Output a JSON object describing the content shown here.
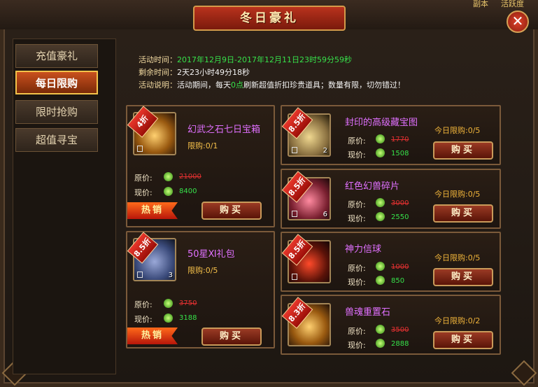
{
  "top_strip": {
    "left": "副本",
    "right": "活跃度"
  },
  "title": "冬日豪礼",
  "close_label": "✕",
  "sidebar": {
    "items": [
      {
        "label": "充值豪礼",
        "active": false
      },
      {
        "label": "每日限购",
        "active": true
      },
      {
        "label": "限时抢购",
        "active": false
      },
      {
        "label": "超值寻宝",
        "active": false
      }
    ]
  },
  "info": {
    "time_label": "活动时间：",
    "time_value": "2017年12月9日-2017年12月11日23时59分59秒",
    "remain_label": "剩余时间：",
    "remain_value": "2天23小时49分18秒",
    "desc_label": "活动说明：",
    "desc_pre": "活动期间，每天",
    "desc_hl": "0点",
    "desc_post": "刷新超值折扣珍贵道具；数量有限，切勿错过！"
  },
  "labels": {
    "orig": "原价:",
    "now": "现价:",
    "buy": "购买",
    "hot": "热销"
  },
  "left_cards": [
    {
      "discount": "4折",
      "name": "幻武之石七日宝箱",
      "limit": "限购:0/1",
      "stack": "",
      "orig": "21000",
      "now": "8400"
    },
    {
      "discount": "8.5折",
      "name": "50星Ⅺ礼包",
      "limit": "限购:0/5",
      "stack": "3",
      "orig": "3750",
      "now": "3188"
    }
  ],
  "right_cards": [
    {
      "discount": "8.5折",
      "name": "封印的高级藏宝图",
      "daily": "今日限购:0/5",
      "stack": "2",
      "orig": "1770",
      "now": "1508"
    },
    {
      "discount": "8.5折",
      "name": "红色幻兽碎片",
      "daily": "今日限购:0/5",
      "stack": "6",
      "orig": "3000",
      "now": "2550"
    },
    {
      "discount": "8.5折",
      "name": "神力信球",
      "daily": "今日限购:0/5",
      "stack": "",
      "orig": "1000",
      "now": "850"
    },
    {
      "discount": "8.3折",
      "name": "兽魂重置石",
      "daily": "今日限购:0/2",
      "stack": "",
      "orig": "3500",
      "now": "2888"
    }
  ]
}
